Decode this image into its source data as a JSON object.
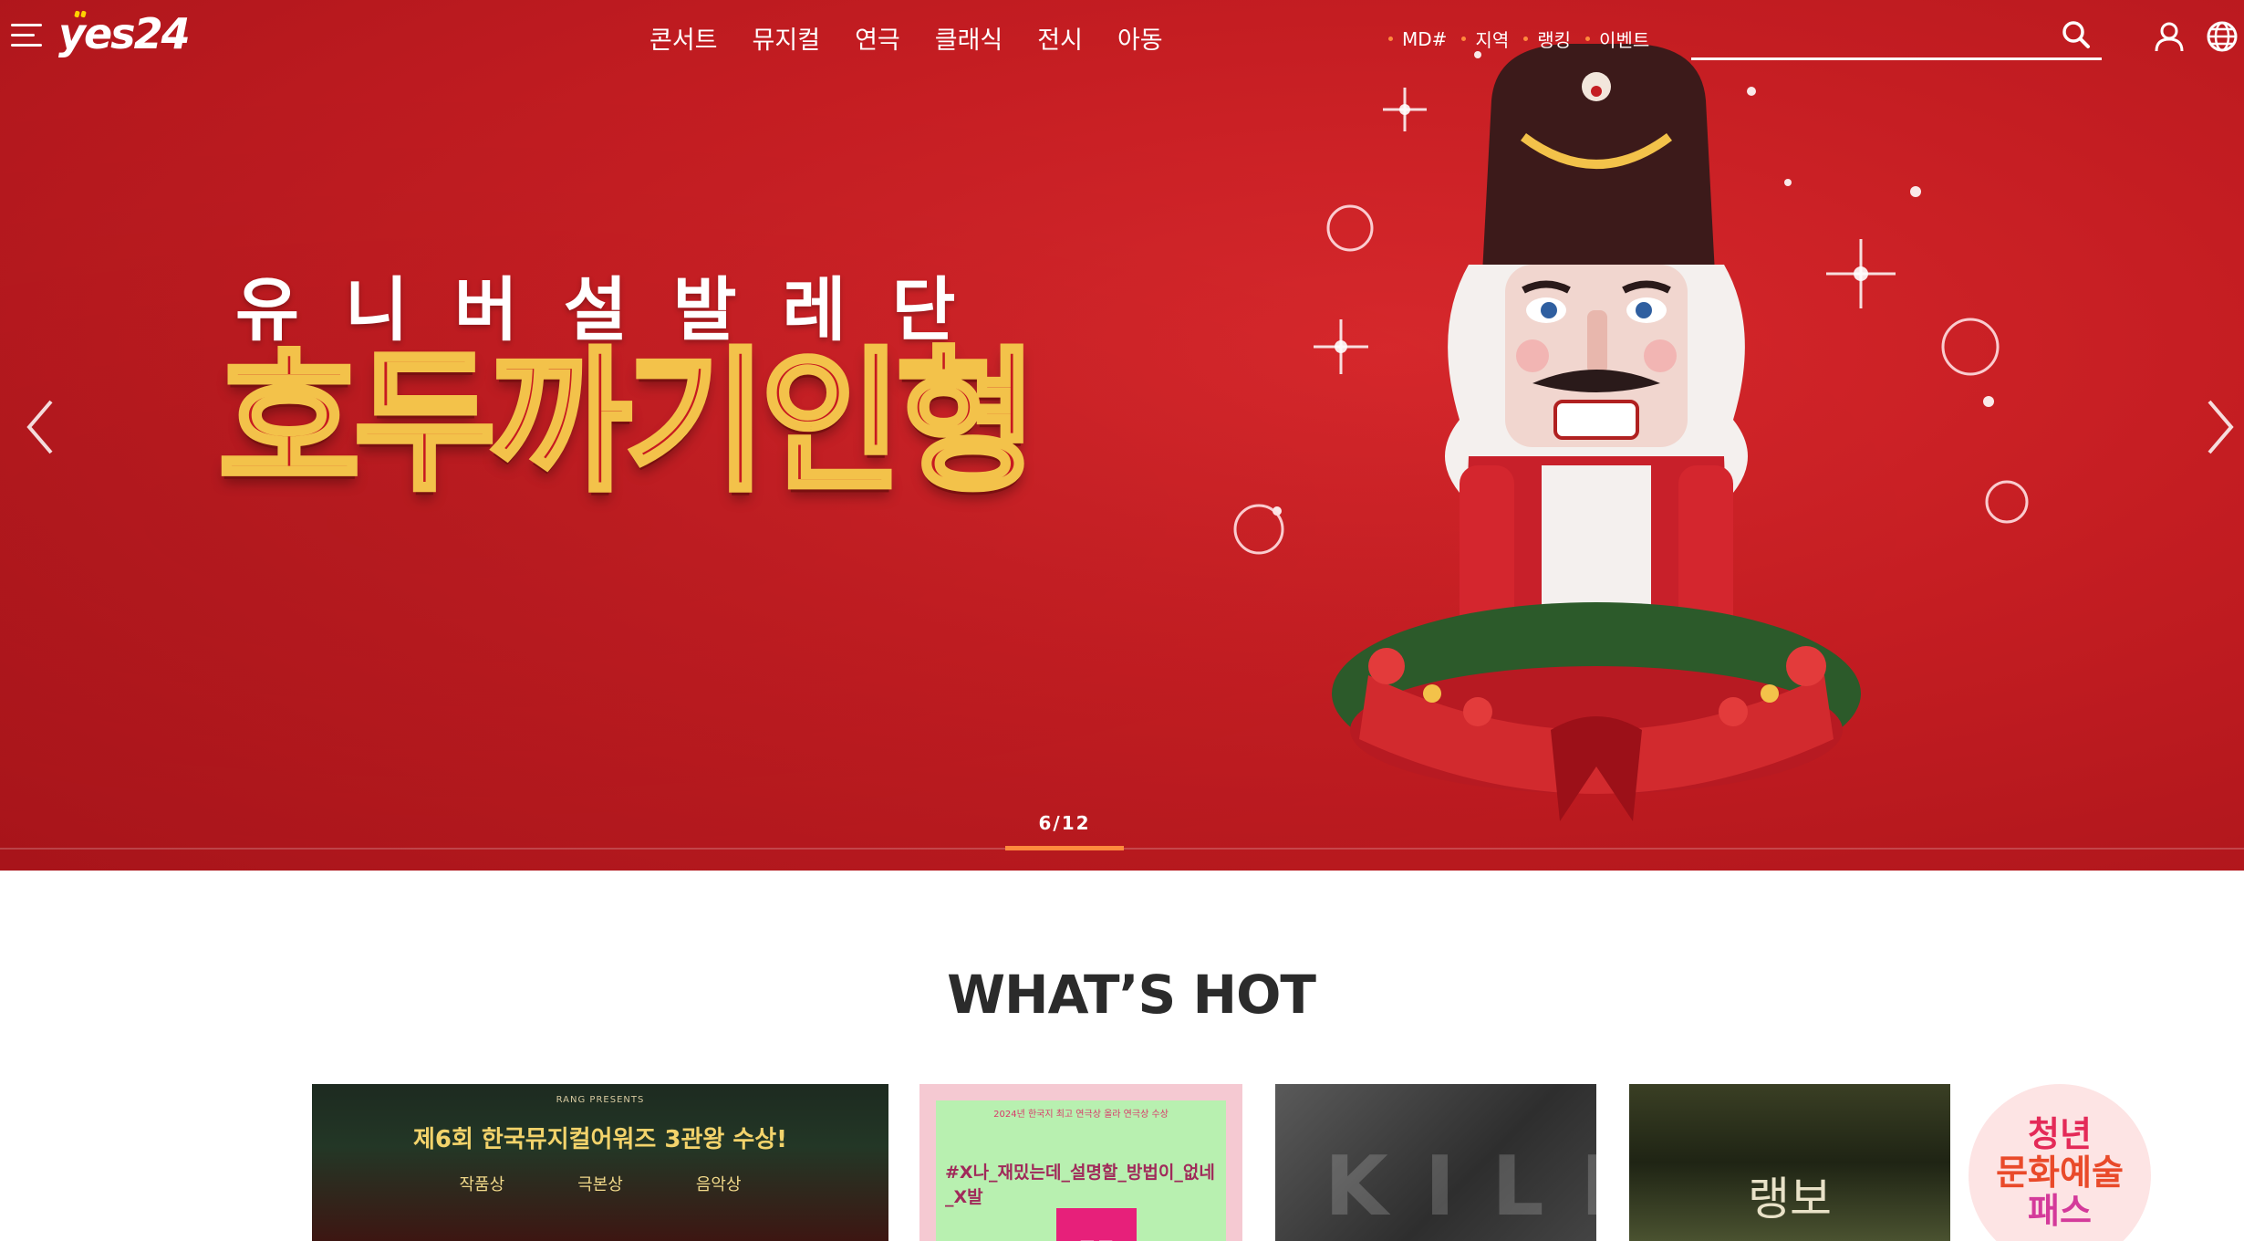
{
  "header": {
    "logo": "yes24",
    "nav": [
      "콘서트",
      "뮤지컬",
      "연극",
      "클래식",
      "전시",
      "아동"
    ],
    "subnav": [
      "MD#",
      "지역",
      "랭킹",
      "이벤트"
    ],
    "search": {
      "value": "",
      "placeholder": ""
    },
    "icons": [
      "menu-icon",
      "search-icon",
      "user-icon",
      "globe-icon"
    ]
  },
  "banner": {
    "subtitle": "유니버설발레단",
    "title": "호두까기인형",
    "pager": "6/12",
    "current": 6,
    "total": 12
  },
  "hot": {
    "title": "WHAT’S HOT",
    "cards": [
      {
        "presenter": "RANG PRESENTS",
        "headline": "제6회 한국뮤지컬어워즈 3관왕 수상!",
        "awards": [
          "작품상",
          "극본상",
          "음악상"
        ]
      },
      {
        "header": "2024년 한국지 최고 연극상 올라 연극상 수상",
        "hashtag": "#X나_재밌는데_설명할_방법이_없네_X발",
        "badge": "토토"
      },
      {
        "art_text": "KILL"
      },
      {
        "art_text": "랭보"
      }
    ],
    "pass": {
      "line1": "청년",
      "line2": "문화예술",
      "line3": "패스"
    }
  },
  "colors": {
    "hero": "#c41d22",
    "accent": "#ff8a3d",
    "gold": "#f3c24a"
  }
}
